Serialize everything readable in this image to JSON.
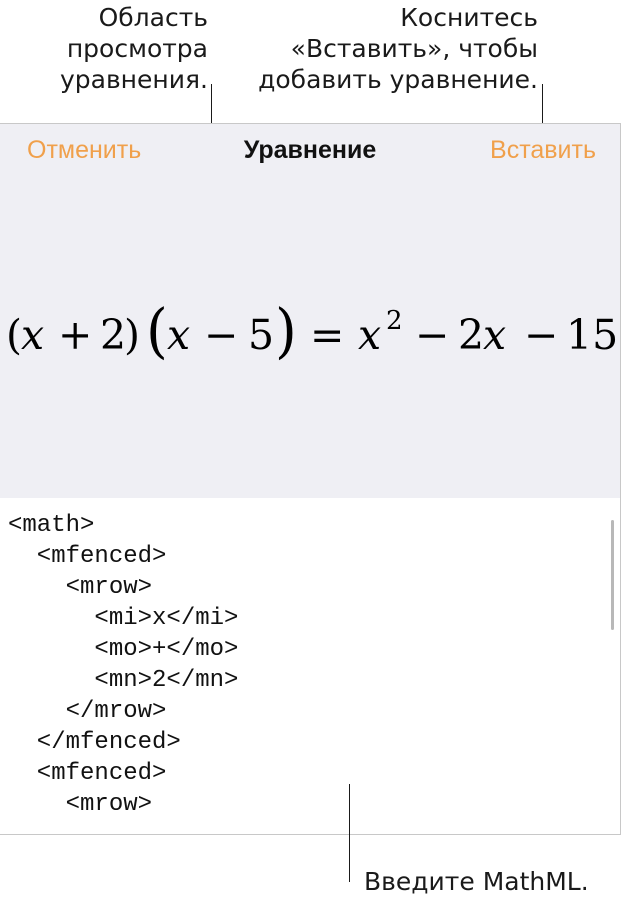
{
  "callouts": {
    "preview": {
      "lines": [
        "Область",
        "просмотра",
        "уравнения."
      ]
    },
    "insert": {
      "lines": [
        "Коснитесь",
        "«Вставить», чтобы",
        "добавить уравнение."
      ]
    },
    "mathml": {
      "text": "Введите MathML."
    }
  },
  "toolbar": {
    "cancel_label": "Отменить",
    "title": "Уравнение",
    "insert_label": "Вставить"
  },
  "equation": {
    "tokens": {
      "lp1": "(",
      "x1": "x",
      "plus": "+",
      "two": "2",
      "rp1": ")",
      "lp2": "(",
      "x2": "x",
      "minus1": "−",
      "five": "5",
      "rp2": ")",
      "eq": "=",
      "x3": "x",
      "exp": "2",
      "minus2": "−",
      "coef": "2",
      "x4": "x",
      "minus3": "−",
      "fifteen": "15"
    }
  },
  "code_lines": [
    "<math>",
    "  <mfenced>",
    "    <mrow>",
    "      <mi>x</mi>",
    "      <mo>+</mo>",
    "      <mn>2</mn>",
    "    </mrow>",
    "  </mfenced>",
    "  <mfenced>",
    "    <mrow>"
  ],
  "colors": {
    "accent": "#f0a04b",
    "preview_bg": "#efeff4",
    "code_bg": "#ffffff",
    "border": "#c8c8c8"
  }
}
